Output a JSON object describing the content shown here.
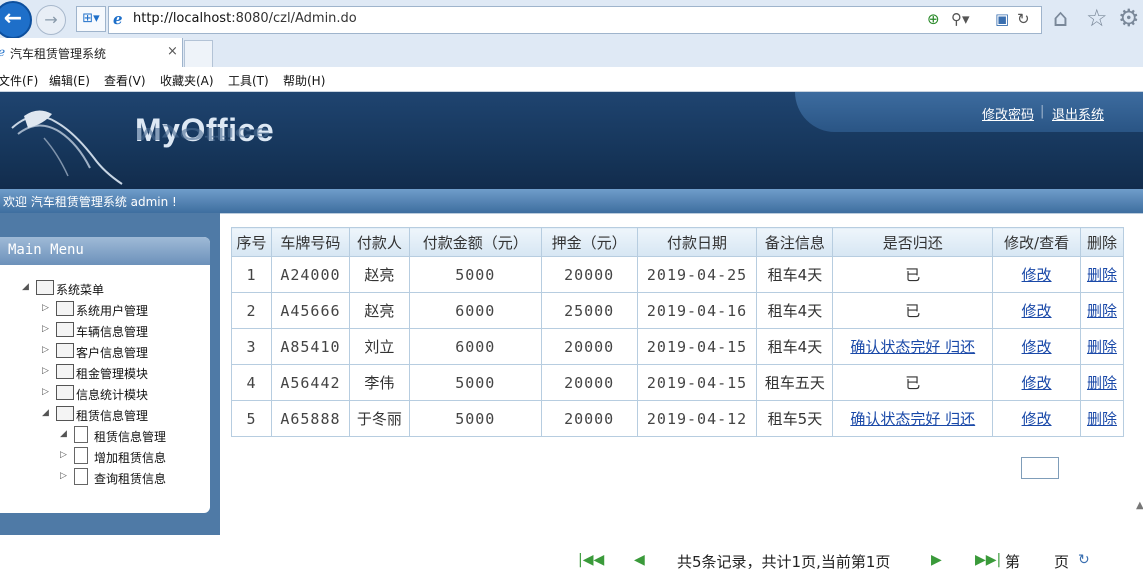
{
  "browser": {
    "back_icon": "back-arrow-icon",
    "forward_icon": "forward-arrow-icon",
    "url_prefix": "http://localhost",
    "url_rest": ":8080/czl/Admin.do",
    "tab_title": "汽车租赁管理系统",
    "tab_close": "×",
    "menu": [
      "文件(F)",
      "编辑(E)",
      "查看(V)",
      "收藏夹(A)",
      "工具(T)",
      "帮助(H)"
    ]
  },
  "header": {
    "logo": "MyOffice",
    "change_password": "修改密码",
    "separator": "|",
    "logout": "退出系统",
    "welcome": "欢迎 汽车租赁管理系统 admin !"
  },
  "sidebar": {
    "title": "Main Menu",
    "root": "系统菜单",
    "items": [
      "系统用户管理",
      "车辆信息管理",
      "客户信息管理",
      "租金管理模块",
      "信息统计模块",
      "租赁信息管理"
    ],
    "sub_items": [
      "租赁信息管理",
      "增加租赁信息",
      "查询租赁信息"
    ]
  },
  "table": {
    "headers": [
      "序号",
      "车牌号码",
      "付款人",
      "付款金额（元）",
      "押金（元）",
      "付款日期",
      "备注信息",
      "是否归还",
      "修改/查看",
      "删除"
    ],
    "rows": [
      {
        "no": "1",
        "plate": "A24000",
        "payer": "赵亮",
        "amount": "5000",
        "deposit": "20000",
        "date": "2019-04-25",
        "note": "租车4天",
        "returned": "已",
        "edit": "修改",
        "delete": "删除"
      },
      {
        "no": "2",
        "plate": "A45666",
        "payer": "赵亮",
        "amount": "6000",
        "deposit": "25000",
        "date": "2019-04-16",
        "note": "租车4天",
        "returned": "已",
        "edit": "修改",
        "delete": "删除"
      },
      {
        "no": "3",
        "plate": "A85410",
        "payer": "刘立",
        "amount": "6000",
        "deposit": "20000",
        "date": "2019-04-15",
        "note": "租车4天",
        "returned": "确认状态完好 归还",
        "edit": "修改",
        "delete": "删除"
      },
      {
        "no": "4",
        "plate": "A56442",
        "payer": "李伟",
        "amount": "5000",
        "deposit": "20000",
        "date": "2019-04-15",
        "note": "租车五天",
        "returned": "已",
        "edit": "修改",
        "delete": "删除"
      },
      {
        "no": "5",
        "plate": "A65888",
        "payer": "于冬丽",
        "amount": "5000",
        "deposit": "20000",
        "date": "2019-04-12",
        "note": "租车5天",
        "returned": "确认状态完好 归还",
        "edit": "修改",
        "delete": "删除"
      }
    ]
  },
  "pager": {
    "summary": "共5条记录，共计1页,当前第1页",
    "page_prefix": "第",
    "page_suffix": "页",
    "page_value": ""
  }
}
